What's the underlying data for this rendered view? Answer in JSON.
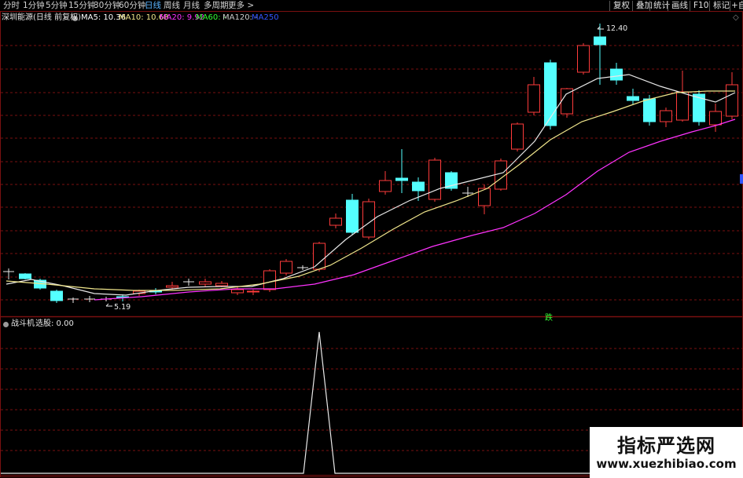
{
  "toolbar": {
    "periods": [
      "分时",
      "1分钟",
      "5分钟",
      "15分钟",
      "30分钟",
      "60分钟",
      "日线",
      "周线",
      "月线",
      "多周期",
      "更多 >"
    ],
    "active_period": "日线",
    "right_buttons": [
      "复权",
      "叠加",
      "统计",
      "画线",
      "F10",
      "标记",
      "+自"
    ]
  },
  "main_panel": {
    "title": "深圳能源(日线 前复权)",
    "ma": [
      {
        "label": "MA5: 10.36",
        "color": "#ffffff"
      },
      {
        "label": "MA10: 10.68",
        "color": "#f0e68c"
      },
      {
        "label": "MA20: 9.92",
        "color": "#ff33ff"
      },
      {
        "label": "MA60: -",
        "color": "#33ff33"
      },
      {
        "label": "MA120: -",
        "color": "#cccccc"
      },
      {
        "label": "MA250",
        "color": "#3355ff"
      }
    ],
    "high_label": "12.40",
    "low_label": "5.19",
    "signal_label": "跌"
  },
  "sub_panel": {
    "indicator": "战斗机",
    "value_label": "选股: 0.00"
  },
  "watermark": {
    "title": "指标严选网",
    "url": "www.xuezhibiao.com"
  },
  "colors": {
    "up": "#ff3b3b",
    "down": "#54ffff",
    "grid": "#7a1010",
    "ma5": "#e8e8e8",
    "ma10": "#f0e68c",
    "ma20": "#ff33ff"
  }
}
